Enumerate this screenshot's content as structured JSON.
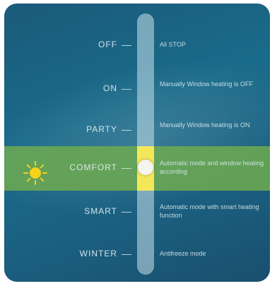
{
  "modes": [
    {
      "label": "OFF",
      "desc": "All STOP"
    },
    {
      "label": "ON",
      "desc": "Manually Window heating is OFF"
    },
    {
      "label": "PARTY",
      "desc": "Manually Window heating is ON"
    },
    {
      "label": "COMFORT",
      "desc": "Automatic mode and window heating according"
    },
    {
      "label": "SMART",
      "desc": "Automatic mode with smart heating function"
    },
    {
      "label": "WINTER",
      "desc": "Antifreeze mode"
    }
  ],
  "active_mode": "COMFORT",
  "colors": {
    "background": "#1a6b8a",
    "highlight": "#6eaa50",
    "active_track": "#f4e85a",
    "sun": "#f6d21a"
  },
  "icons": {
    "active_mode_icon": "sun-icon"
  }
}
